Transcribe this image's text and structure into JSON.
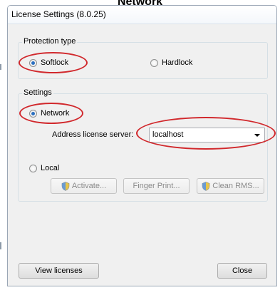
{
  "heading": "Network",
  "window": {
    "title": "License Settings (8.0.25)"
  },
  "protection": {
    "legend": "Protection type",
    "softlock_label": "Softlock",
    "hardlock_label": "Hardlock"
  },
  "settings": {
    "legend": "Settings",
    "network_label": "Network",
    "address_label": "Address license server:",
    "address_value": "localhost",
    "local_label": "Local",
    "activate_label": "Activate...",
    "fingerprint_label": "Finger Print...",
    "clean_label": "Clean RMS..."
  },
  "footer": {
    "view_licenses_label": "View licenses",
    "close_label": "Close"
  },
  "colors": {
    "annotation": "#d1282c",
    "accent": "#2a6fc0"
  }
}
